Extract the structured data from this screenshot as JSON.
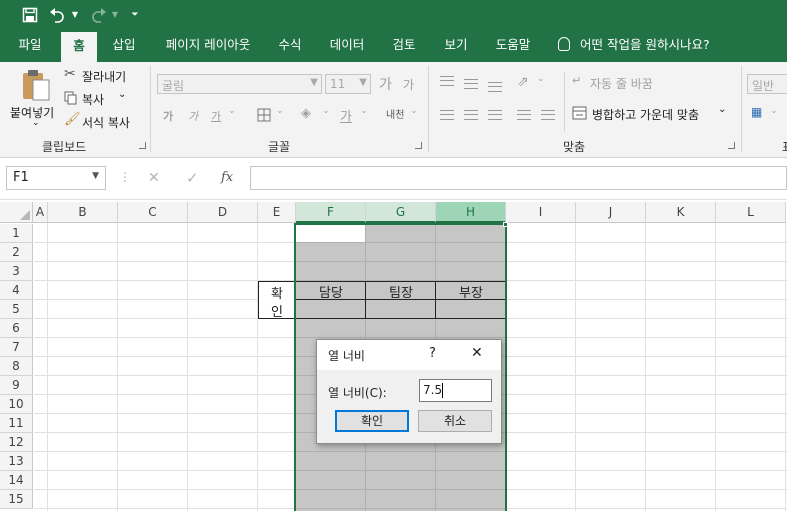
{
  "qat": {
    "save_icon": "save-icon",
    "undo_icon": "undo-icon",
    "redo_icon": "redo-icon",
    "customize_icon": "customize-icon"
  },
  "tabs": [
    {
      "label": "파일"
    },
    {
      "label": "홈"
    },
    {
      "label": "삽입"
    },
    {
      "label": "페이지 레이아웃"
    },
    {
      "label": "수식"
    },
    {
      "label": "데이터"
    },
    {
      "label": "검토"
    },
    {
      "label": "보기"
    },
    {
      "label": "도움말"
    }
  ],
  "tell_me": "어떤 작업을 원하시나요?",
  "ribbon": {
    "clipboard": {
      "paste": "붙여넣기",
      "cut": "잘라내기",
      "copy": "복사",
      "format_painter": "서식 복사",
      "label": "클립보드"
    },
    "font": {
      "font_name": "굴림",
      "font_size": "11",
      "grow": "가",
      "shrink": "가",
      "bold": "가",
      "italic": "가",
      "underline": "가",
      "font_color": "가",
      "phonetic": "내천",
      "label": "글꼴"
    },
    "alignment": {
      "wrap_text": "자동 줄 바꿈",
      "merge_center": "병합하고 가운데 맞춤",
      "label": "맞춤"
    },
    "number": {
      "format": "일반",
      "label": "표"
    }
  },
  "formula_bar": {
    "name_box": "F1",
    "cancel": "✕",
    "enter": "✓",
    "fx": "fx",
    "value": ""
  },
  "columns": [
    "A",
    "B",
    "C",
    "D",
    "E",
    "F",
    "G",
    "H",
    "I",
    "J",
    "K",
    "L"
  ],
  "rows": [
    "1",
    "2",
    "3",
    "4",
    "5",
    "6",
    "7",
    "8",
    "9",
    "10",
    "11",
    "12",
    "13",
    "14",
    "15"
  ],
  "cells": {
    "e4": "확",
    "e5": "인",
    "f4": "담당",
    "g4": "팀장",
    "h4": "부장"
  },
  "dialog": {
    "title": "열 너비",
    "help": "?",
    "close": "✕",
    "field_label": "열 너비(C):",
    "field_value": "7.5",
    "ok": "확인",
    "cancel": "취소"
  },
  "colors": {
    "accent": "#217346",
    "selection": "#c6c6c6",
    "header_selected": "#d2e7d9"
  }
}
